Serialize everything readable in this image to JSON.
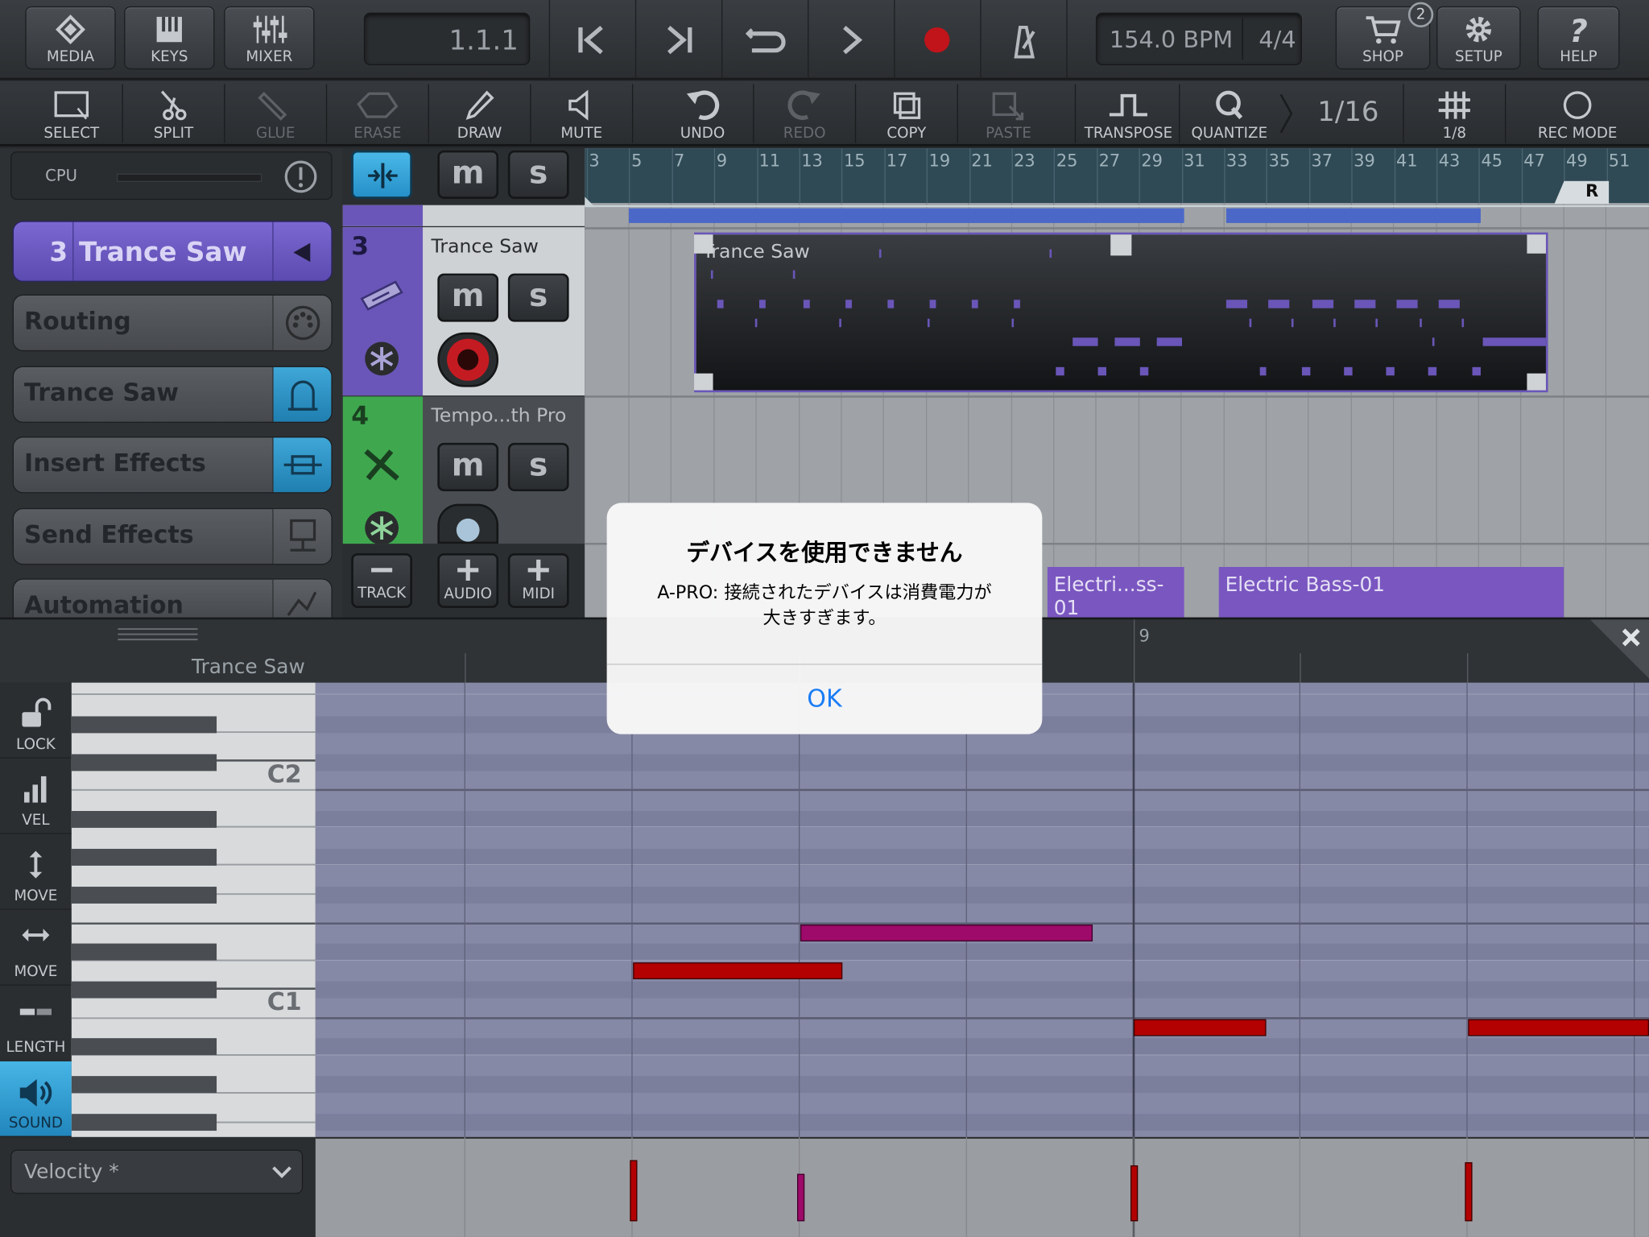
{
  "toolbar_top": {
    "buttons": [
      {
        "label": "MEDIA",
        "icon": "media-icon"
      },
      {
        "label": "KEYS",
        "icon": "keys-icon"
      },
      {
        "label": "MIXER",
        "icon": "mixer-icon"
      }
    ],
    "position": "1.1.1",
    "tempo": "154.0 BPM",
    "signature": "4/4",
    "right_buttons": [
      {
        "label": "SHOP",
        "icon": "cart-icon",
        "badge": "2"
      },
      {
        "label": "SETUP",
        "icon": "gear-icon"
      },
      {
        "label": "HELP",
        "icon": "help-icon"
      }
    ]
  },
  "toolbar_tools": {
    "select": "SELECT",
    "split": "SPLIT",
    "glue": "GLUE",
    "erase": "ERASE",
    "draw": "DRAW",
    "mute": "MUTE",
    "undo": "UNDO",
    "redo": "REDO",
    "copy": "COPY",
    "paste": "PASTE",
    "transpose": "TRANSPOSE",
    "quantize": "QUANTIZE",
    "quantize_value": "1/16",
    "grid_value": "1/8",
    "rec_mode": "REC MODE"
  },
  "inspector": {
    "cpu_label": "CPU",
    "track_number": "3",
    "track_name": "Trance Saw",
    "routing": "Routing",
    "instrument": "Trance Saw",
    "insert_effects": "Insert Effects",
    "send_effects": "Send Effects",
    "automation": "Automation"
  },
  "tracks": [
    {
      "number": "3",
      "name": "Trance Saw",
      "mute": "m",
      "solo": "s"
    },
    {
      "number": "4",
      "name": "Tempo...th Pro",
      "mute": "m",
      "solo": "s"
    }
  ],
  "track_actions": {
    "remove": "TRACK",
    "audio": "AUDIO",
    "midi": "MIDI"
  },
  "header_buttons": {
    "mute": "m",
    "solo": "s"
  },
  "ruler": {
    "ticks": [
      "3",
      "5",
      "7",
      "9",
      "11",
      "13",
      "15",
      "17",
      "19",
      "21",
      "23",
      "25",
      "27",
      "29",
      "31",
      "33",
      "35",
      "37",
      "39",
      "41",
      "43",
      "45",
      "47",
      "49",
      "51"
    ],
    "r_label": "R"
  },
  "arrangement": {
    "midi_part": "Trance Saw",
    "bass_parts": [
      "Electri...ss-01",
      "Electric Bass-01"
    ]
  },
  "piano_roll": {
    "track_name": "Trance Saw",
    "bar_label": "9",
    "key_labels": [
      "C2",
      "C1"
    ],
    "side_tools": [
      {
        "label": "LOCK",
        "icon": "lock-open-icon"
      },
      {
        "label": "VEL",
        "icon": "velocity-icon"
      },
      {
        "label": "MOVE",
        "icon": "move-vertical-icon"
      },
      {
        "label": "MOVE",
        "icon": "move-horizontal-icon"
      },
      {
        "label": "LENGTH",
        "icon": "length-icon"
      },
      {
        "label": "SOUND",
        "icon": "speaker-icon"
      }
    ],
    "velocity_selector": "Velocity *"
  },
  "dialog": {
    "title": "デバイスを使用できません",
    "message_line1": "A-PRO: 接続されたデバイスは消費電力が",
    "message_line2": "大きすぎます。",
    "ok": "OK"
  },
  "colors": {
    "accent_purple": "#6a56b8",
    "track_green": "#3fa84f",
    "note_red": "#b30000",
    "note_magenta": "#9e0a6a",
    "ios_blue": "#1a7df5"
  }
}
